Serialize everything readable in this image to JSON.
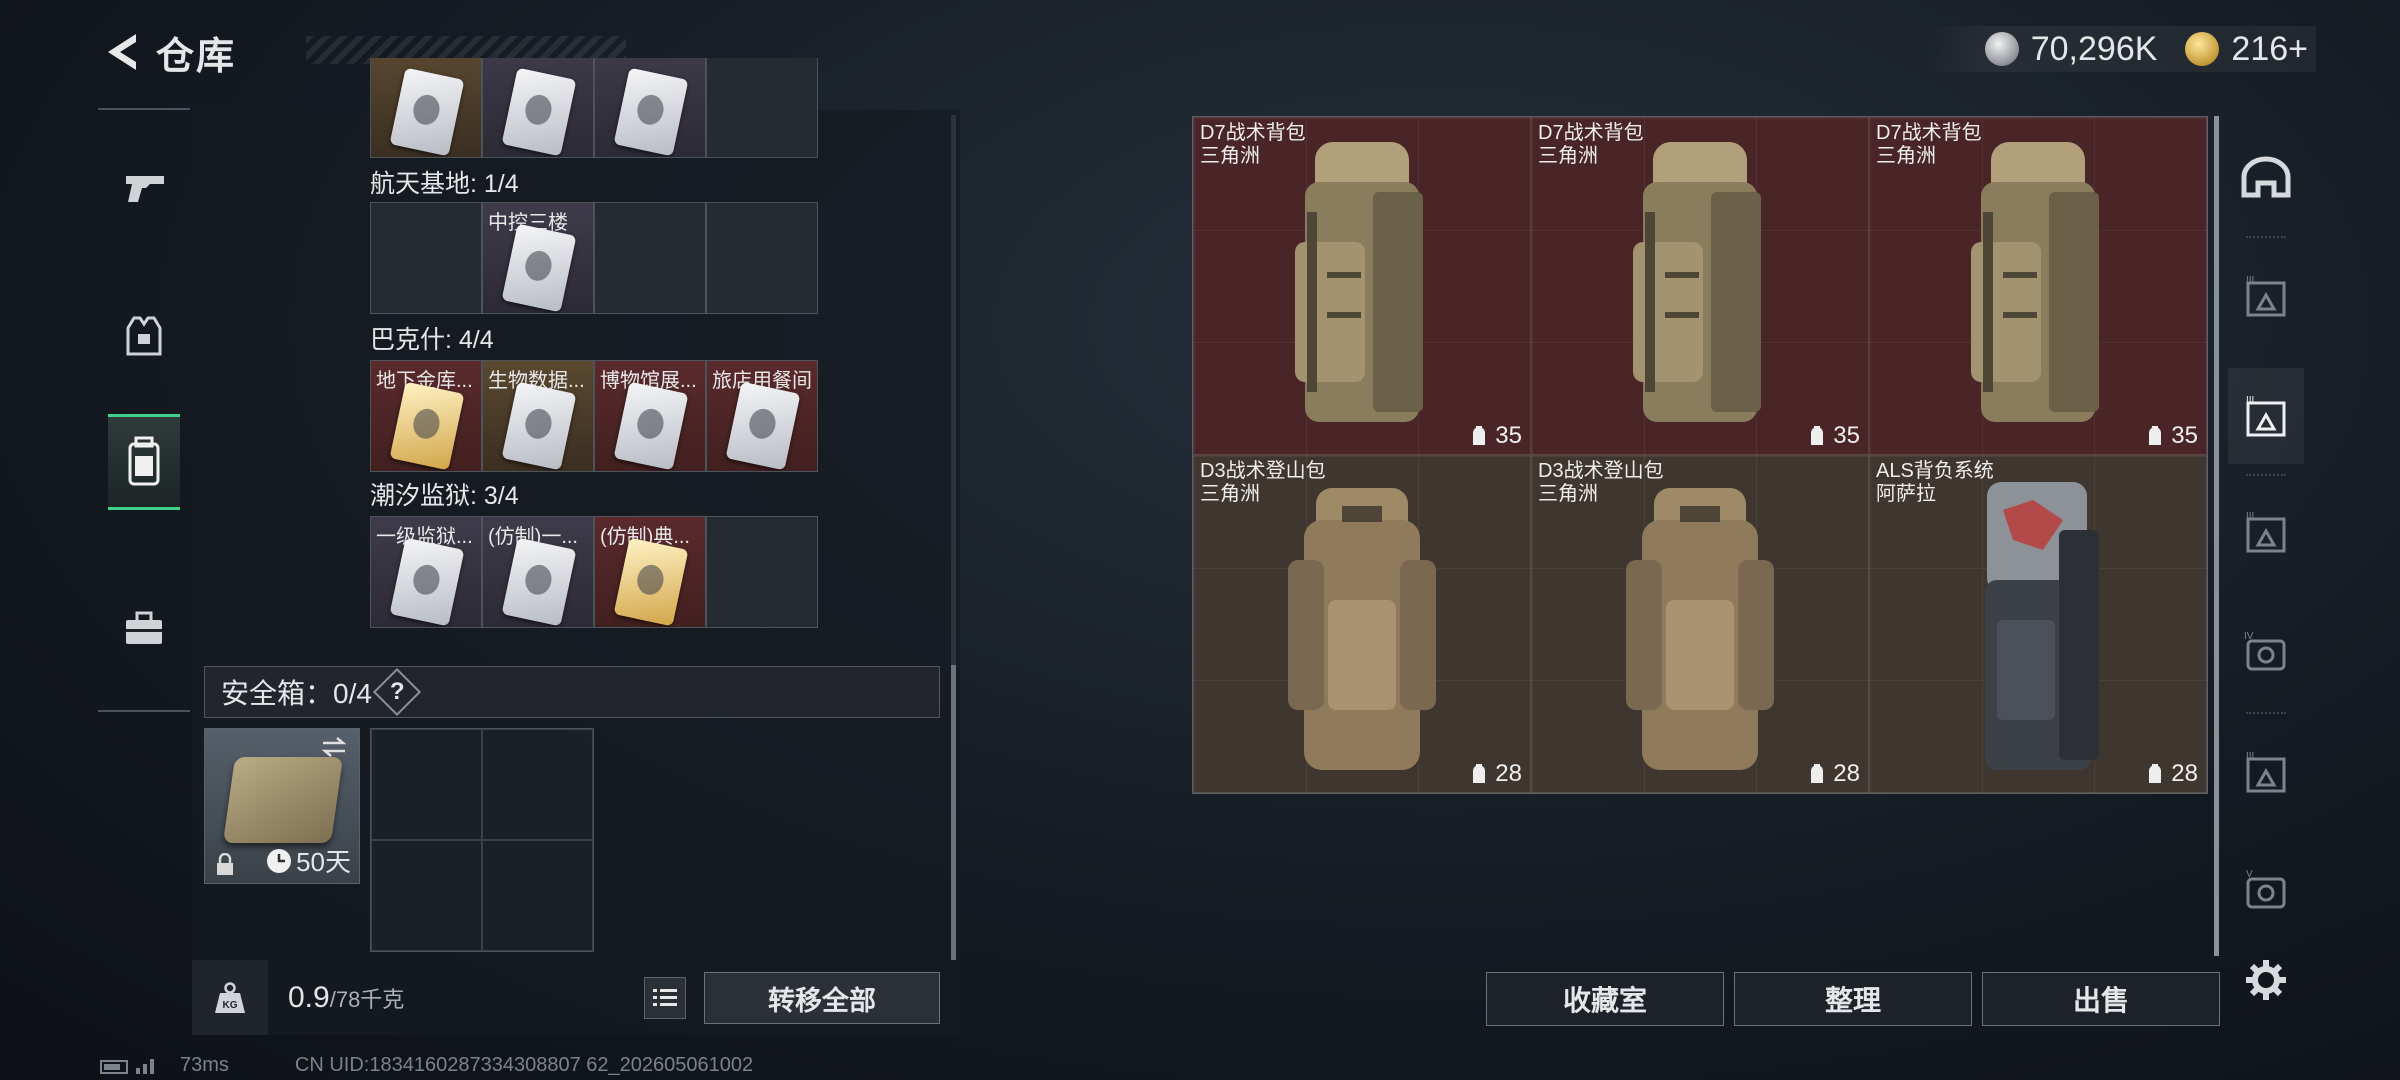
{
  "header": {
    "title": "仓库"
  },
  "currency": {
    "silver": "70,296K",
    "gold": "216+"
  },
  "left_nav": [
    "weapon-icon",
    "armor-icon",
    "backpack-icon",
    "briefcase-icon"
  ],
  "keys": {
    "top_partial_row": [
      "",
      "",
      "",
      ""
    ],
    "sections": [
      {
        "label": "航天基地: 1/4",
        "items": [
          {
            "name": "",
            "tone": "empty"
          },
          {
            "name": "中控三楼",
            "tone": "gray"
          },
          {
            "name": "",
            "tone": "empty"
          },
          {
            "name": "",
            "tone": "empty"
          }
        ]
      },
      {
        "label": "巴克什: 4/4",
        "items": [
          {
            "name": "地下金库...",
            "tone": "red"
          },
          {
            "name": "生物数据...",
            "tone": "gold"
          },
          {
            "name": "博物馆展...",
            "tone": "red"
          },
          {
            "name": "旅店用餐间",
            "tone": "red"
          }
        ]
      },
      {
        "label": "潮汐监狱: 3/4",
        "items": [
          {
            "name": "一级监狱...",
            "tone": "gray"
          },
          {
            "name": "(仿制)一...",
            "tone": "gray"
          },
          {
            "name": "(仿制)典...",
            "tone": "red"
          },
          {
            "name": "",
            "tone": "empty"
          }
        ]
      }
    ]
  },
  "safe_box": {
    "label": "安全箱：0/4",
    "help": "?",
    "days": "50天"
  },
  "bottom": {
    "weight": "0.9",
    "weight_max": "/78千克",
    "transfer_all": "转移全部"
  },
  "status": {
    "ping": "73ms",
    "uid": "CN UID:1834160287334308807 62_202605061002"
  },
  "storage": [
    {
      "name": "D7战术背包",
      "map": "三角洲",
      "capacity": "35",
      "tone": "red"
    },
    {
      "name": "D7战术背包",
      "map": "三角洲",
      "capacity": "35",
      "tone": "red"
    },
    {
      "name": "D7战术背包",
      "map": "三角洲",
      "capacity": "35",
      "tone": "red"
    },
    {
      "name": "D3战术登山包",
      "map": "三角洲",
      "capacity": "28",
      "tone": "brown"
    },
    {
      "name": "D3战术登山包",
      "map": "三角洲",
      "capacity": "28",
      "tone": "brown"
    },
    {
      "name": "ALS背负系统",
      "map": "阿萨拉",
      "capacity": "28",
      "tone": "brown"
    }
  ],
  "right_nav": [
    "helmet-icon",
    "armor-tier3-icon",
    "armor-tier3-selected-icon",
    "armor-tier3-alt-icon",
    "armor-tier4-icon",
    "armor-tier3-b-icon",
    "armor-tier5-icon"
  ],
  "actions": {
    "collection": "收藏室",
    "organize": "整理",
    "sell": "出售"
  }
}
